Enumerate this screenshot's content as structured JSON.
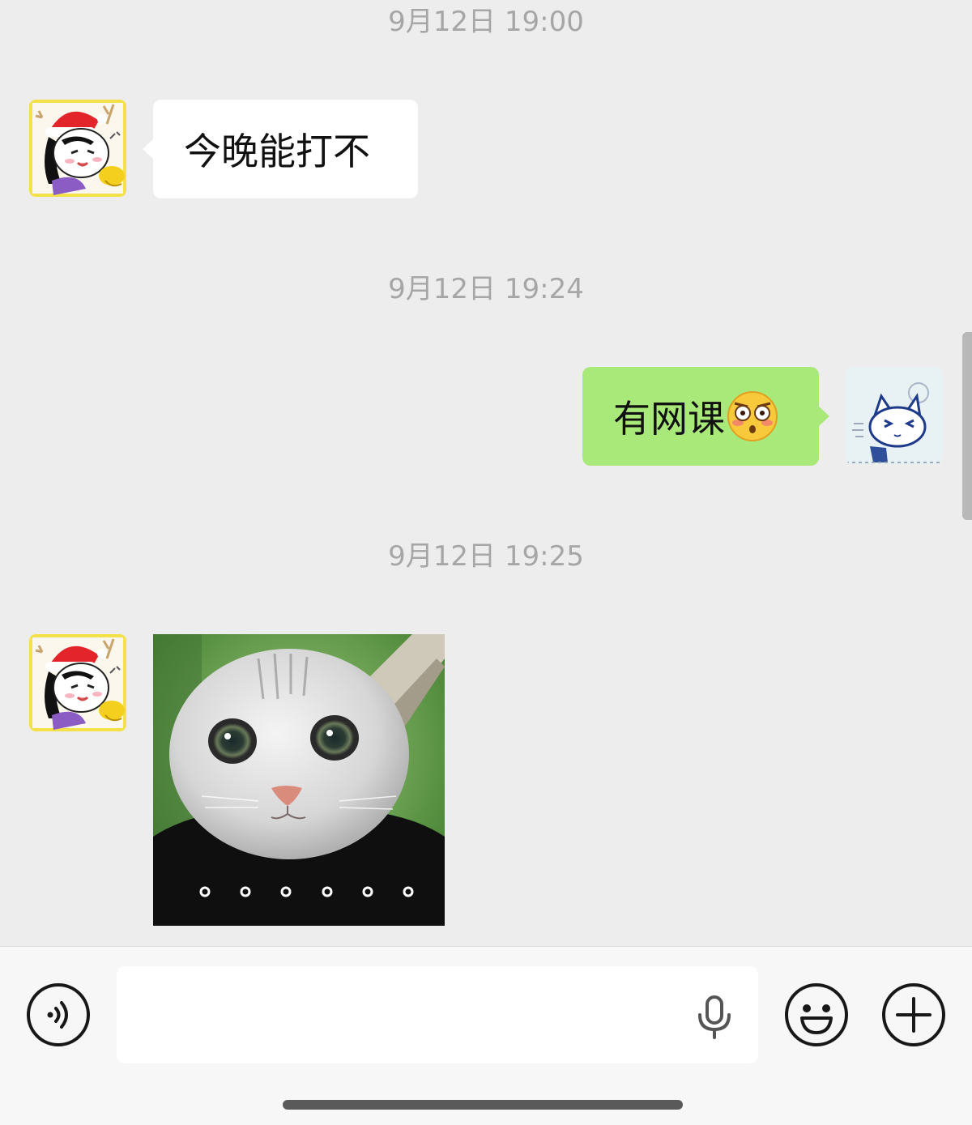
{
  "messages": [
    {
      "type": "timestamp",
      "text": "9月12日 19:00"
    },
    {
      "type": "text",
      "side": "left",
      "text": "今晚能打不"
    },
    {
      "type": "timestamp",
      "text": "9月12日 19:24"
    },
    {
      "type": "text",
      "side": "right",
      "text": "有网课",
      "emoji": "flushed-face-emoji"
    },
    {
      "type": "timestamp",
      "text": "9月12日 19:25"
    },
    {
      "type": "image",
      "side": "left",
      "content": "white-cat-sticker",
      "dots": "o o o o o o"
    }
  ],
  "input_bar": {
    "voice_icon": "voice-mode-icon",
    "text_value": "",
    "mic_icon": "microphone-icon",
    "emoji_icon": "emoji-icon",
    "more_icon": "plus-icon"
  },
  "colors": {
    "background": "#ededed",
    "bubble_received": "#ffffff",
    "bubble_sent": "#a9e97a",
    "timestamp": "#a6a6a6"
  }
}
